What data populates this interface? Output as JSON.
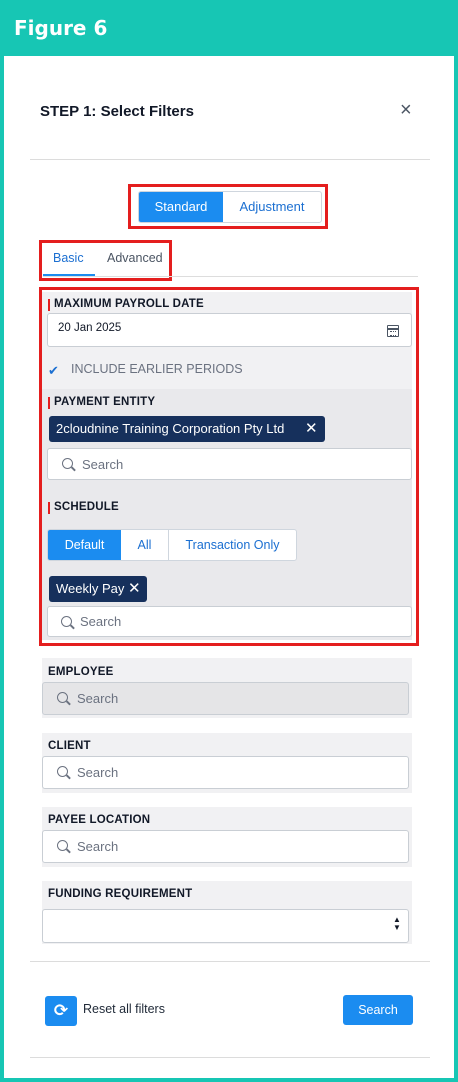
{
  "figure": {
    "title": "Figure 6"
  },
  "panel": {
    "title": "STEP 1: Select Filters",
    "close_glyph": "×"
  },
  "mode_toggle": {
    "standard": "Standard",
    "adjustment": "Adjustment",
    "selected": "Standard"
  },
  "tabs": {
    "basic": "Basic",
    "advanced": "Advanced",
    "selected": "Basic"
  },
  "max_payroll_date": {
    "label": "MAXIMUM PAYROLL DATE",
    "value": "20 Jan 2025",
    "include_earlier": {
      "label": "INCLUDE EARLIER PERIODS",
      "checked": true,
      "glyph": "✔"
    }
  },
  "payment_entity": {
    "label": "PAYMENT ENTITY",
    "chip": "2cloudnine Training Corporation Pty Ltd",
    "search_placeholder": "Search"
  },
  "schedule": {
    "label": "SCHEDULE",
    "options": {
      "default": "Default",
      "all": "All",
      "transaction_only": "Transaction Only"
    },
    "selected": "Default",
    "chip": "Weekly Pay",
    "search_placeholder": "Search"
  },
  "employee": {
    "label": "EMPLOYEE",
    "search_placeholder": "Search"
  },
  "client": {
    "label": "CLIENT",
    "search_placeholder": "Search"
  },
  "payee_location": {
    "label": "PAYEE LOCATION",
    "search_placeholder": "Search"
  },
  "funding_requirement": {
    "label": "FUNDING REQUIREMENT",
    "value": ""
  },
  "footer": {
    "reset_label": "Reset all filters",
    "reset_glyph": "⟳",
    "search_label": "Search"
  },
  "glyphs": {
    "chip_remove": "✕",
    "select_arrows_up": "▲",
    "select_arrows_down": "▼"
  },
  "colors": {
    "accent": "#1b8cf0",
    "chip": "#16305c",
    "frame": "#17c6b4",
    "highlight": "#e41e1e"
  }
}
